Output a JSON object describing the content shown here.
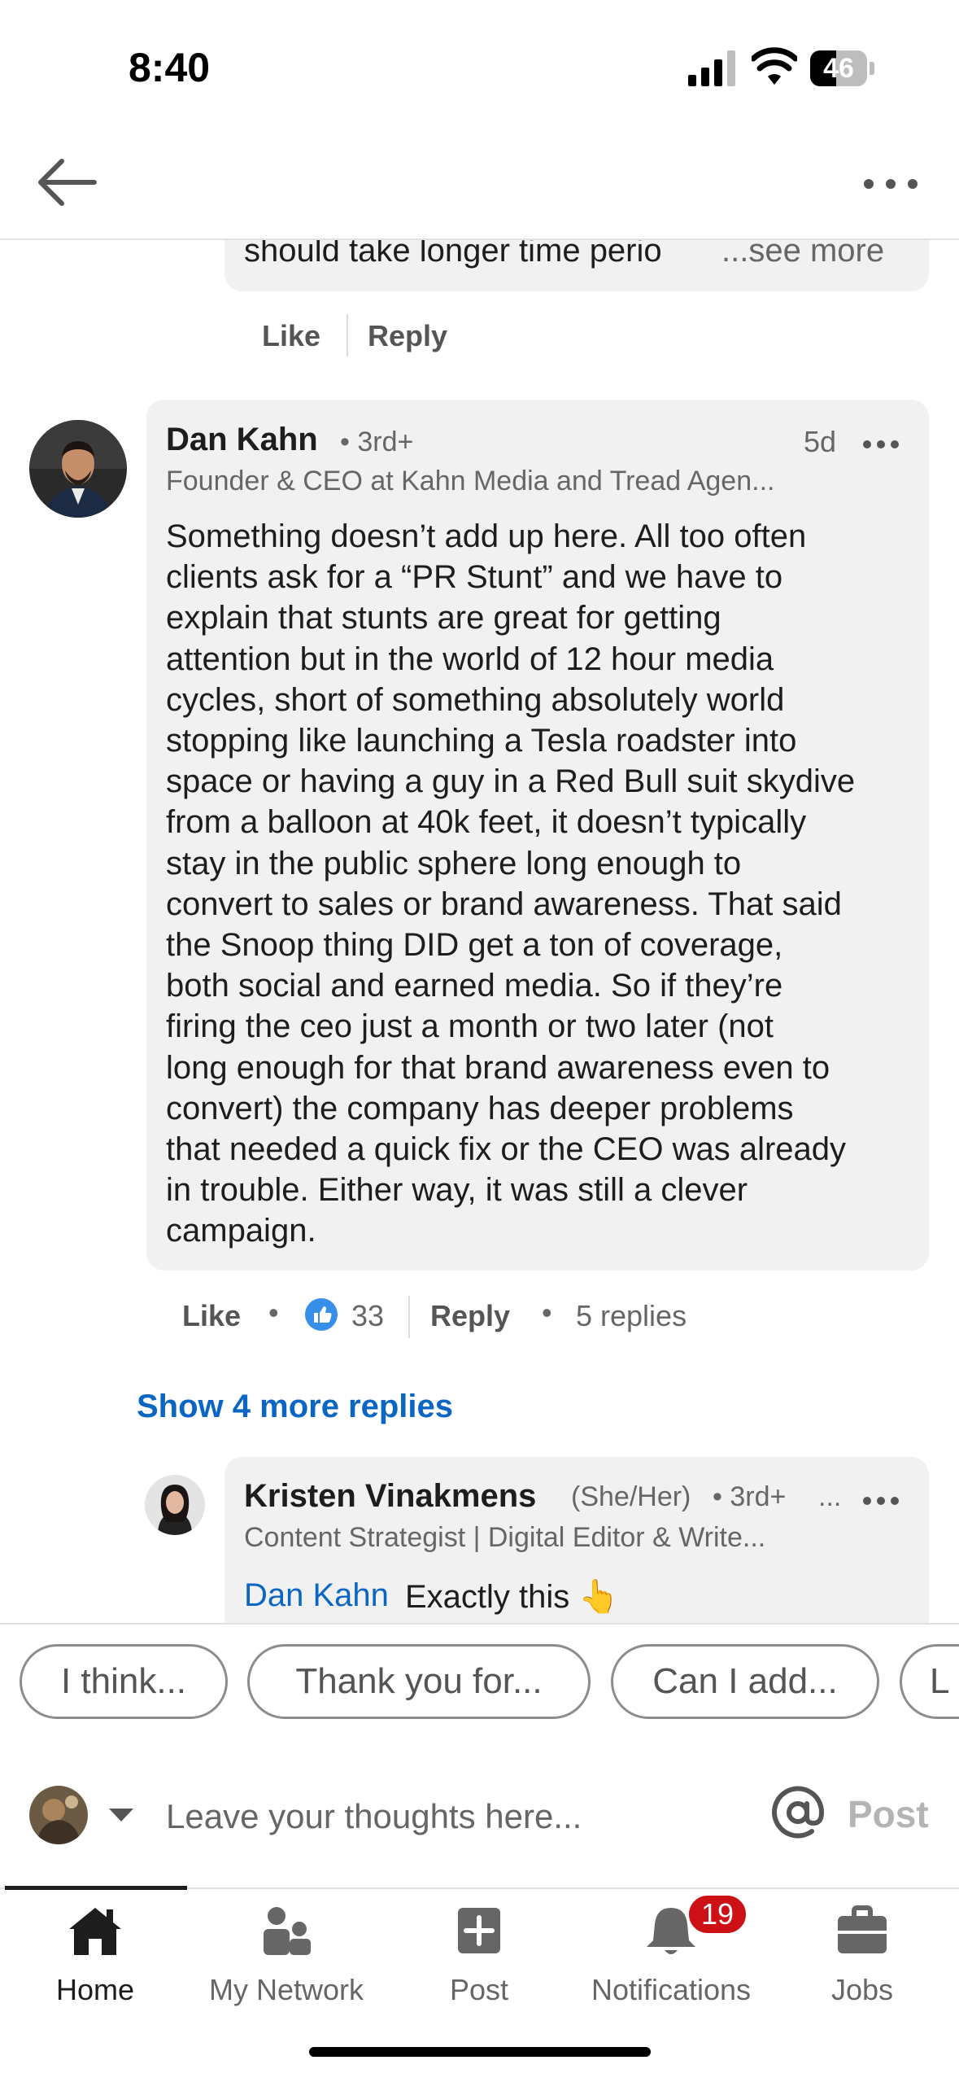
{
  "status_bar": {
    "time": "8:40",
    "battery": "46"
  },
  "previous_comment": {
    "text": "should take longer time perio",
    "see_more": "...see more",
    "like": "Like",
    "reply": "Reply"
  },
  "comment": {
    "author": "Dan Kahn",
    "degree": "• 3rd+",
    "time": "5d",
    "headline": "Founder & CEO at Kahn Media and Tread Agen...",
    "body_lines": [
      "Something doesn’t add up here. All too often",
      "clients ask for a “PR Stunt” and we have to",
      "explain that stunts are great for getting",
      "attention but in the world of 12 hour media",
      "cycles, short of something absolutely world",
      "stopping like launching a Tesla roadster into",
      "space or having a guy in a Red Bull suit skydive",
      "from a balloon at 40k feet, it doesn’t typically",
      "stay in the public sphere long enough to",
      "convert to sales or brand awareness. That said",
      "the Snoop thing DID get a ton of coverage,",
      "both social and earned media. So if they’re",
      "firing the ceo just a month or two later (not",
      "long enough for that brand awareness even to",
      "convert) the company has deeper problems",
      "that needed a quick fix or the CEO was already",
      "in trouble. Either way, it was still a clever",
      "campaign."
    ],
    "actions": {
      "like": "Like",
      "dot": "•",
      "reaction_count": "33",
      "reply": "Reply",
      "replies": "5 replies"
    }
  },
  "show_more_replies": "Show 4 more replies",
  "reply": {
    "author": "Kristen Vinakmens",
    "pronouns": "(She/Her)",
    "degree": "• 3rd+",
    "ellipsis": "...",
    "headline": "Content Strategist | Digital Editor & Write...",
    "mention": "Dan Kahn",
    "text": "Exactly this 👆"
  },
  "suggestions": [
    "I think...",
    "Thank you for...",
    "Can I add...",
    "L"
  ],
  "composer": {
    "placeholder": "Leave your thoughts here...",
    "post": "Post"
  },
  "nav": {
    "items": [
      {
        "label": "Home",
        "icon": "home-icon"
      },
      {
        "label": "My Network",
        "icon": "network-icon"
      },
      {
        "label": "Post",
        "icon": "post-icon"
      },
      {
        "label": "Notifications",
        "icon": "bell-icon"
      },
      {
        "label": "Jobs",
        "icon": "briefcase-icon"
      }
    ],
    "notifications_badge": "19"
  },
  "colors": {
    "link": "#0a66c2",
    "bubble": "#f1f1f1",
    "badge": "#cc1016",
    "reaction": "#378fe9"
  }
}
